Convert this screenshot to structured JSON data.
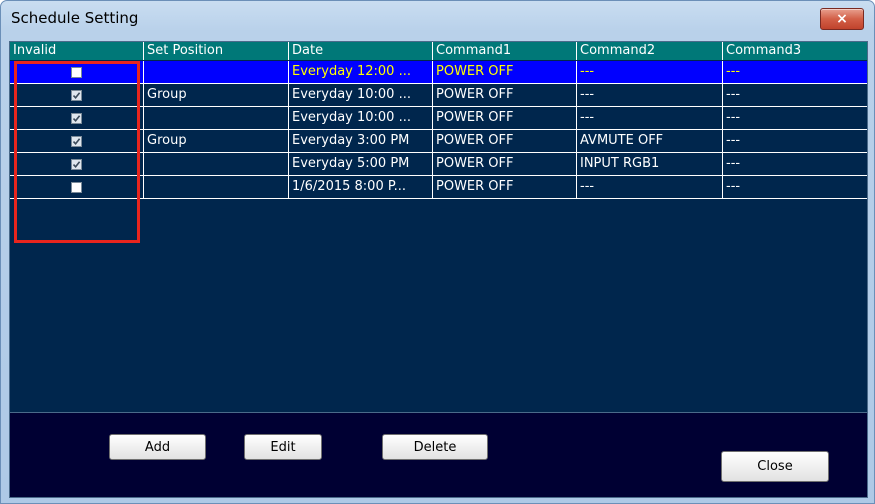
{
  "window": {
    "title": "Schedule Setting",
    "close_glyph": "×"
  },
  "table": {
    "columns": [
      "Invalid",
      "Set Position",
      "Date",
      "Command1",
      "Command2",
      "Command3"
    ],
    "rows": [
      {
        "invalid": false,
        "set_position": "",
        "date": "Everyday 12:00 ...",
        "command1": "POWER OFF",
        "command2": "---",
        "command3": "---",
        "selected": true
      },
      {
        "invalid": true,
        "set_position": "Group",
        "date": "Everyday 10:00 ...",
        "command1": "POWER OFF",
        "command2": "---",
        "command3": "---",
        "selected": false
      },
      {
        "invalid": true,
        "set_position": "",
        "date": "Everyday 10:00 ...",
        "command1": "POWER OFF",
        "command2": "---",
        "command3": "---",
        "selected": false
      },
      {
        "invalid": true,
        "set_position": "Group",
        "date": "Everyday 3:00 PM",
        "command1": "POWER OFF",
        "command2": "AVMUTE OFF",
        "command3": "---",
        "selected": false
      },
      {
        "invalid": true,
        "set_position": "",
        "date": "Everyday 5:00 PM",
        "command1": "POWER OFF",
        "command2": "INPUT RGB1",
        "command3": "---",
        "selected": false
      },
      {
        "invalid": false,
        "set_position": "",
        "date": "1/6/2015 8:00 P...",
        "command1": "POWER OFF",
        "command2": "---",
        "command3": "---",
        "selected": false
      }
    ]
  },
  "buttons": {
    "add": "Add",
    "edit": "Edit",
    "delete": "Delete",
    "close": "Close"
  },
  "colors": {
    "grid_bg": "#00264d",
    "header_bg": "#007878",
    "selected_row": "#0000ff",
    "selected_text": "#ffff00",
    "highlight_box": "#e8251e"
  }
}
